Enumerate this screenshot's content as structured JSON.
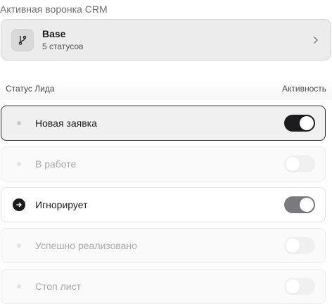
{
  "section_title": "Активная воронка CRM",
  "funnel": {
    "icon": "branch-icon",
    "name": "Base",
    "subtitle": "5 статусов"
  },
  "table_header": {
    "left": "Статус Лида",
    "right": "Активность"
  },
  "statuses": [
    {
      "label": "Новая заявка",
      "active": true,
      "lead_icon": "dot"
    },
    {
      "label": "В работе",
      "active": false,
      "lead_icon": "dot"
    },
    {
      "label": "Игнорирует",
      "active": true,
      "lead_icon": "arrow-right-circle"
    },
    {
      "label": "Успешно реализовано",
      "active": false,
      "lead_icon": "dot"
    },
    {
      "label": "Стоп лист",
      "active": false,
      "lead_icon": "dot"
    }
  ],
  "colors": {
    "toggle_on_dark": "#1c1c1e",
    "toggle_on_grey": "#7a7a7e",
    "toggle_off": "#f0f0f0"
  }
}
